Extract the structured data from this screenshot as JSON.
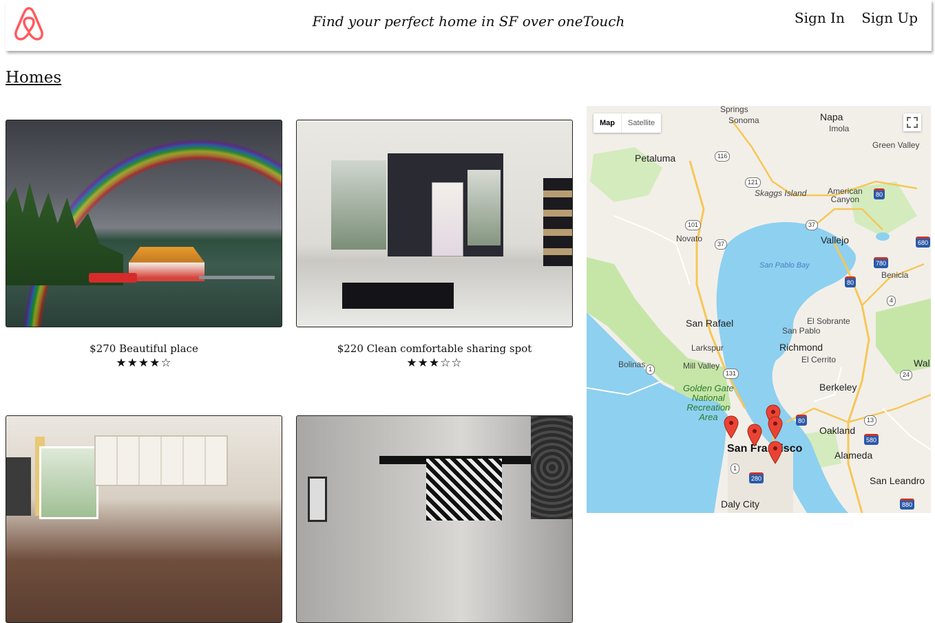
{
  "header": {
    "tagline": "Find your perfect home in SF over oneTouch",
    "sign_in": "Sign In",
    "sign_up": "Sign Up",
    "brand_color": "#ff5a5f"
  },
  "page_title": "Homes",
  "listings": [
    {
      "caption": "$270 Beautiful place",
      "stars": "★★★★☆",
      "rating": 4,
      "image": "rainbow-lake-cabin"
    },
    {
      "caption": "$220 Clean comfortable sharing spot",
      "stars": "★★★☆☆",
      "rating": 3,
      "image": "minimal-interior"
    },
    {
      "caption": "",
      "stars": "",
      "image": "kitchen"
    },
    {
      "caption": "",
      "stars": "",
      "image": "bedroom"
    }
  ],
  "map": {
    "toggle": {
      "map": "Map",
      "satellite": "Satellite",
      "selected": "Map"
    },
    "labels": {
      "springs": "Springs",
      "sonoma": "Sonoma",
      "napa": "Napa",
      "imola": "Imola",
      "green_valley": "Green Valley",
      "petaluma": "Petaluma",
      "skaggs_island": "Skaggs Island",
      "american_canyon": "American\nCanyon",
      "novato": "Novato",
      "vallejo": "Vallejo",
      "san_pablo_bay": "San Pablo Bay",
      "benicia": "Benicia",
      "san_rafael": "San Rafael",
      "el_sobrante": "El Sobrante",
      "san_pablo": "San Pablo",
      "larkspur": "Larkspur",
      "richmond": "Richmond",
      "bolinas": "Bolinas",
      "mill_valley": "Mill Valley",
      "el_cerrito": "El Cerrito",
      "wal": "Wal",
      "golden_gate": "Golden Gate\nNational\nRecreation\nArea",
      "berkeley": "Berkeley",
      "oakland": "Oakland",
      "san_francisco": "San Francisco",
      "alameda": "Alameda",
      "san_leandro": "San Leandro",
      "daly_city": "Daly City"
    },
    "shields": [
      "116",
      "121",
      "101",
      "37",
      "37",
      "80",
      "680",
      "780",
      "80",
      "4",
      "1",
      "131",
      "24",
      "80",
      "13",
      "580",
      "1",
      "280",
      "880"
    ],
    "marker_color": "#ea4335",
    "water_color": "#8ed0f0",
    "land_color": "#f2efe9",
    "park_color": "#c6e6a8"
  }
}
